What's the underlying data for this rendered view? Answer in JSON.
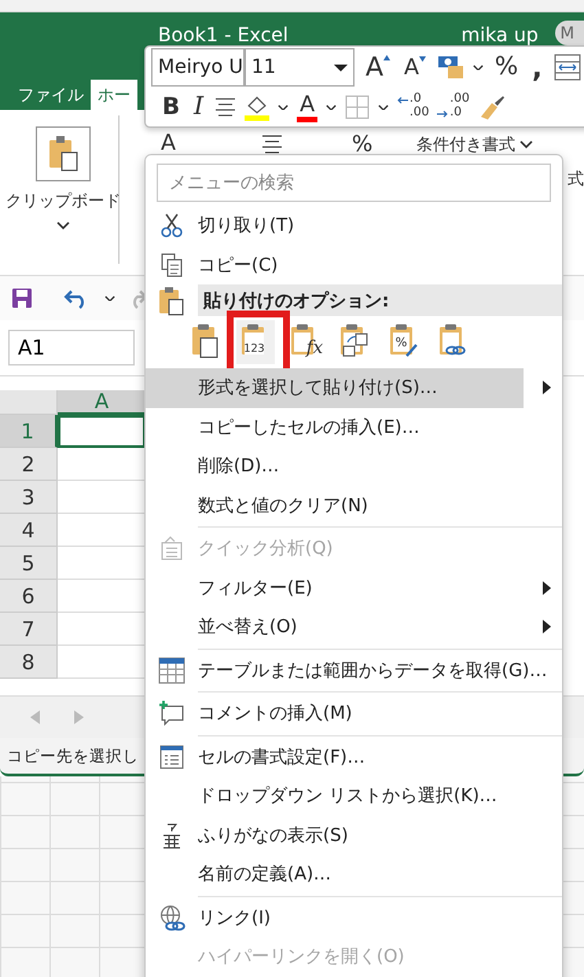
{
  "background_window": {
    "title": "Book1  -  Excel",
    "user": "mika up",
    "avatar": "M"
  },
  "ribbon_tabs": [
    {
      "label": "ファイル",
      "selected": false
    },
    {
      "label": "ホー",
      "selected": true
    }
  ],
  "ribbon": {
    "clipboard_group": "クリップボード",
    "font_color": "A",
    "percent": "%",
    "conditional_format": "条件付き書式",
    "styles_partial": "式"
  },
  "name_box": "A1",
  "sheet": {
    "columns": [
      "A"
    ],
    "rows": [
      {
        "label": "1",
        "selected": true
      },
      {
        "label": "2",
        "selected": false
      },
      {
        "label": "3",
        "selected": false
      },
      {
        "label": "4",
        "selected": false
      },
      {
        "label": "5",
        "selected": false
      },
      {
        "label": "6",
        "selected": false
      },
      {
        "label": "7",
        "selected": false
      },
      {
        "label": "8",
        "selected": false
      }
    ]
  },
  "status_bar": "コピー先を選択し",
  "mini_toolbar": {
    "font": "Meiryo U",
    "size": "11",
    "grow_font": "A",
    "shrink_font": "A",
    "percent": "%",
    "comma": ",",
    "bold": "B",
    "italic": "I",
    "font_color": "A",
    "increase_decimal": [
      ".0",
      ".00"
    ],
    "decrease_decimal": [
      ".00",
      ".0"
    ]
  },
  "context_menu": {
    "search_placeholder": "メニューの検索",
    "items": [
      {
        "kind": "item",
        "label": "切り取り(T)",
        "disabled": false,
        "submenu": false,
        "selected": false
      },
      {
        "kind": "item",
        "label": "コピー(C)",
        "disabled": false,
        "submenu": false,
        "selected": false
      },
      {
        "kind": "header",
        "label": "貼り付けのオプション:"
      },
      {
        "kind": "paste_options",
        "options": [
          {
            "selected": false
          },
          {
            "glyph": "123",
            "selected": true
          },
          {
            "glyph": "fx",
            "selected": false
          },
          {
            "selected": false
          },
          {
            "glyph": "%",
            "selected": false
          },
          {
            "selected": false
          }
        ]
      },
      {
        "kind": "item",
        "label": "形式を選択して貼り付け(S)…",
        "disabled": false,
        "submenu": true,
        "selected": true
      },
      {
        "kind": "item",
        "label": "コピーしたセルの挿入(E)…",
        "disabled": false,
        "submenu": false,
        "selected": false
      },
      {
        "kind": "item",
        "label": "削除(D)…",
        "disabled": false,
        "submenu": false,
        "selected": false
      },
      {
        "kind": "item",
        "label": "数式と値のクリア(N)",
        "disabled": false,
        "submenu": false,
        "selected": false
      },
      {
        "kind": "separator"
      },
      {
        "kind": "item",
        "label": "クイック分析(Q)",
        "disabled": true,
        "submenu": false,
        "selected": false
      },
      {
        "kind": "item",
        "label": "フィルター(E)",
        "disabled": false,
        "submenu": true,
        "selected": false
      },
      {
        "kind": "item",
        "label": "並べ替え(O)",
        "disabled": false,
        "submenu": true,
        "selected": false
      },
      {
        "kind": "separator"
      },
      {
        "kind": "item",
        "label": "テーブルまたは範囲からデータを取得(G)…",
        "disabled": false,
        "submenu": false,
        "selected": false
      },
      {
        "kind": "separator"
      },
      {
        "kind": "item",
        "label": "コメントの挿入(M)",
        "disabled": false,
        "submenu": false,
        "selected": false
      },
      {
        "kind": "separator"
      },
      {
        "kind": "item",
        "label": "セルの書式設定(F)…",
        "disabled": false,
        "submenu": false,
        "selected": false
      },
      {
        "kind": "item",
        "label": "ドロップダウン リストから選択(K)…",
        "disabled": false,
        "submenu": false,
        "selected": false
      },
      {
        "kind": "item",
        "label": "ふりがなの表示(S)",
        "disabled": false,
        "submenu": false,
        "selected": false
      },
      {
        "kind": "item",
        "label": "名前の定義(A)…",
        "disabled": false,
        "submenu": false,
        "selected": false
      },
      {
        "kind": "separator"
      },
      {
        "kind": "item",
        "label": "リンク(I)",
        "disabled": false,
        "submenu": false,
        "selected": false
      },
      {
        "kind": "item",
        "label": "ハイパーリンクを開く(O)",
        "disabled": true,
        "submenu": false,
        "selected": false
      }
    ]
  }
}
